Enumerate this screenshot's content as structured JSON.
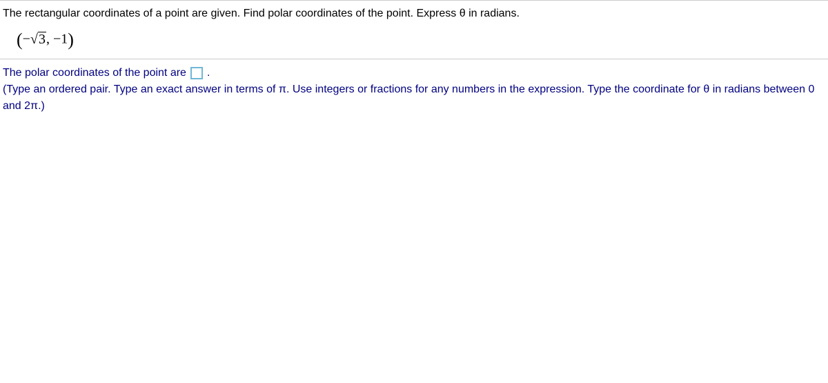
{
  "question": {
    "prompt": "The rectangular coordinates of a point are given. Find polar coordinates of the point. Express θ in radians.",
    "point_open": "(",
    "point_minus1": "−",
    "point_sqrt_arg": "3",
    "point_sep": ", −1",
    "point_close": ")"
  },
  "answer": {
    "lead": "The polar coordinates of the point are",
    "period": ".",
    "instruction": "(Type an ordered pair. Type an exact answer in terms of π. Use integers or fractions for any numbers in the expression. Type the coordinate for θ in radians between 0 and 2π.)"
  }
}
